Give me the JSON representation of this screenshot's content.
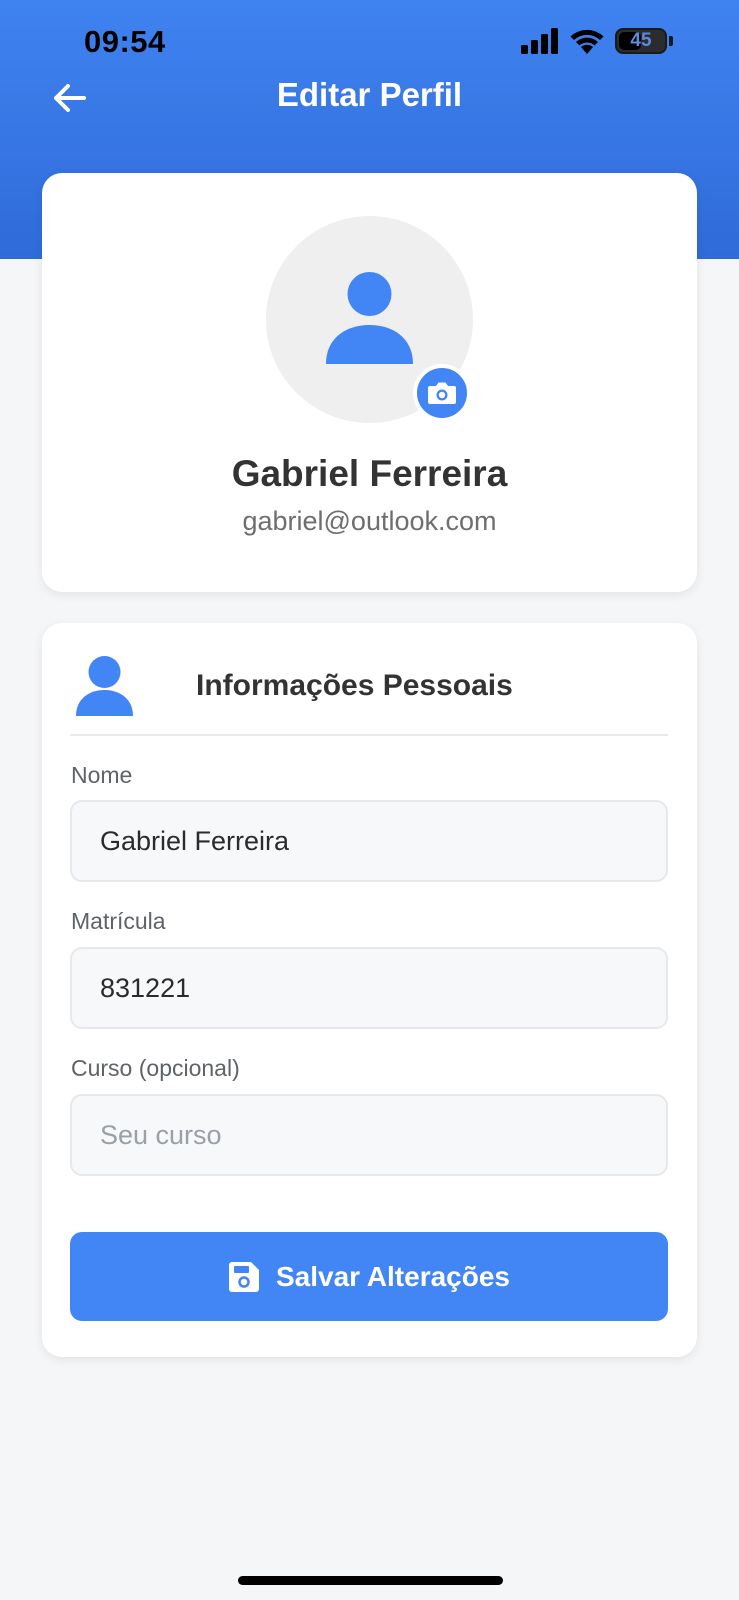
{
  "status_bar": {
    "time": "09:54",
    "battery_level": "45"
  },
  "header": {
    "title": "Editar Perfil",
    "back_icon": "arrow-left-icon"
  },
  "profile": {
    "name": "Gabriel Ferreira",
    "email": "gabriel@outlook.com",
    "avatar_icon": "person-icon",
    "camera_icon": "camera-icon"
  },
  "personal_info": {
    "section_title": "Informações Pessoais",
    "section_icon": "person-icon",
    "fields": [
      {
        "label": "Nome",
        "value": "Gabriel Ferreira",
        "placeholder": ""
      },
      {
        "label": "Matrícula",
        "value": "831221",
        "placeholder": ""
      },
      {
        "label": "Curso (opcional)",
        "value": "",
        "placeholder": "Seu curso"
      }
    ],
    "save_label": "Salvar Alterações",
    "save_icon": "floppy-disk-icon"
  },
  "colors": {
    "primary": "#4285f4",
    "header_gradient_top": "#3f83f0",
    "header_gradient_bottom": "#2f6bd9",
    "background": "#f5f6f8"
  }
}
